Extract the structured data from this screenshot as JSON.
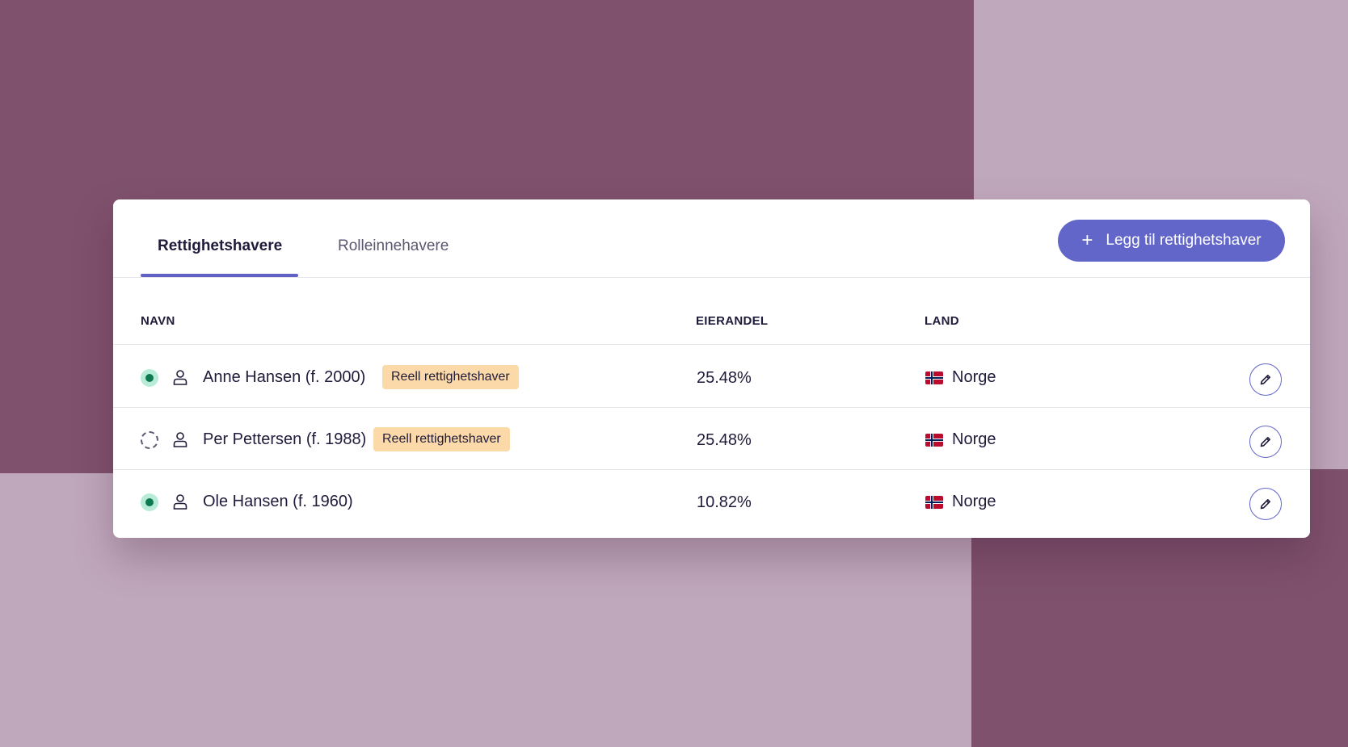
{
  "tabs": [
    {
      "label": "Rettighetshavere",
      "active": true
    },
    {
      "label": "Rolleinnehavere",
      "active": false
    }
  ],
  "add_button": {
    "label": "Legg til rettighetshaver",
    "icon": "plus-icon"
  },
  "table": {
    "headers": {
      "name": "NAVN",
      "share": "EIERANDEL",
      "country": "LAND"
    },
    "rows": [
      {
        "status": "filled",
        "name": "Anne Hansen (f. 2000)",
        "badge": "Reell rettighetshaver",
        "share": "25.48%",
        "country": "Norge"
      },
      {
        "status": "empty",
        "name": "Per Pettersen (f. 1988)",
        "badge": "Reell rettighetshaver",
        "share": "25.48%",
        "country": "Norge"
      },
      {
        "status": "filled",
        "name": "Ole Hansen (f. 1960)",
        "badge": "",
        "share": "10.82%",
        "country": "Norge"
      }
    ]
  },
  "colors": {
    "accent": "#6266c9",
    "badge_bg": "#fbd9a8",
    "status_green": "#0f7a52",
    "bg_dark": "#7f516d",
    "bg_light": "#c0a8bc"
  }
}
